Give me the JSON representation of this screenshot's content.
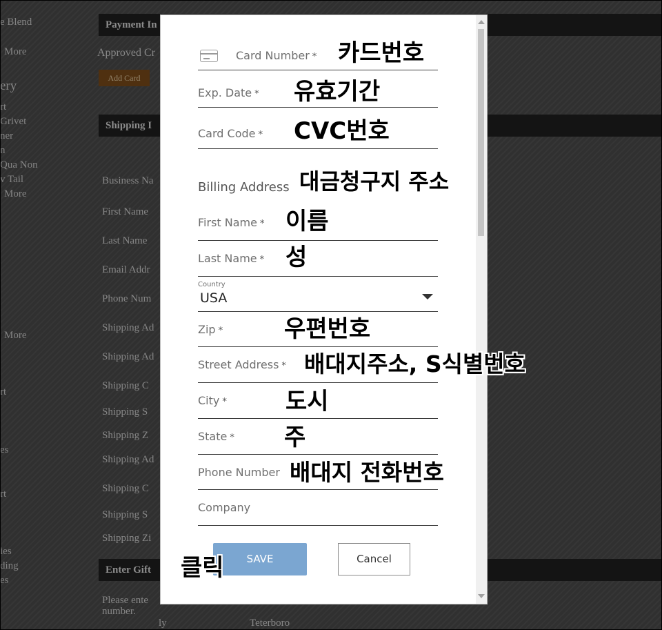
{
  "background": {
    "sidebar": [
      "e Blend",
      "More",
      "ery",
      "rt",
      "Grivet",
      "ner",
      "n",
      "Qua Non",
      "v Tail",
      "More",
      "More",
      "rt",
      "es",
      "rt",
      "ies",
      "ding",
      "es"
    ],
    "bars": [
      "Payment In",
      "Shipping I",
      "Enter Gift"
    ],
    "approved": "Approved Cr",
    "add_button": "Add Card",
    "fields": [
      "Business Na",
      "First Name",
      "Last Name",
      "Email Addr",
      "Phone Num",
      "Shipping Ad",
      "Shipping Ad",
      "Shipping C",
      "Shipping S",
      "Shipping Z",
      "Shipping Ad",
      "Shipping C",
      "Shipping S",
      "Shipping Zi"
    ],
    "footer_text": "Please ente number.",
    "footer_city": "ly",
    "footer_place": "Teterboro"
  },
  "modal": {
    "fields": {
      "card_number": "Card Number",
      "exp_date": "Exp. Date",
      "card_code": "Card Code",
      "billing_address": "Billing Address",
      "first_name": "First Name",
      "last_name": "Last Name",
      "country_caption": "Country",
      "country_value": "USA",
      "zip": "Zip",
      "street_address": "Street Address",
      "city": "City",
      "state": "State",
      "phone_number": "Phone Number",
      "company": "Company"
    },
    "required_mark": "*",
    "save_label": "SAVE",
    "cancel_label": "Cancel"
  },
  "annotations": {
    "card_number": "카드번호",
    "exp_date": "유효기간",
    "card_code": "CVC번호",
    "billing_address": "대금청구지 주소",
    "first_name": "이름",
    "last_name": "성",
    "zip": "우편번호",
    "street_address": "배대지주소, S식별번호",
    "city": "도시",
    "state": "주",
    "phone_number": "배대지 전화번호",
    "click": "클릭"
  },
  "icons": {
    "card": "credit-card-icon",
    "dropdown": "caret-down-icon"
  }
}
